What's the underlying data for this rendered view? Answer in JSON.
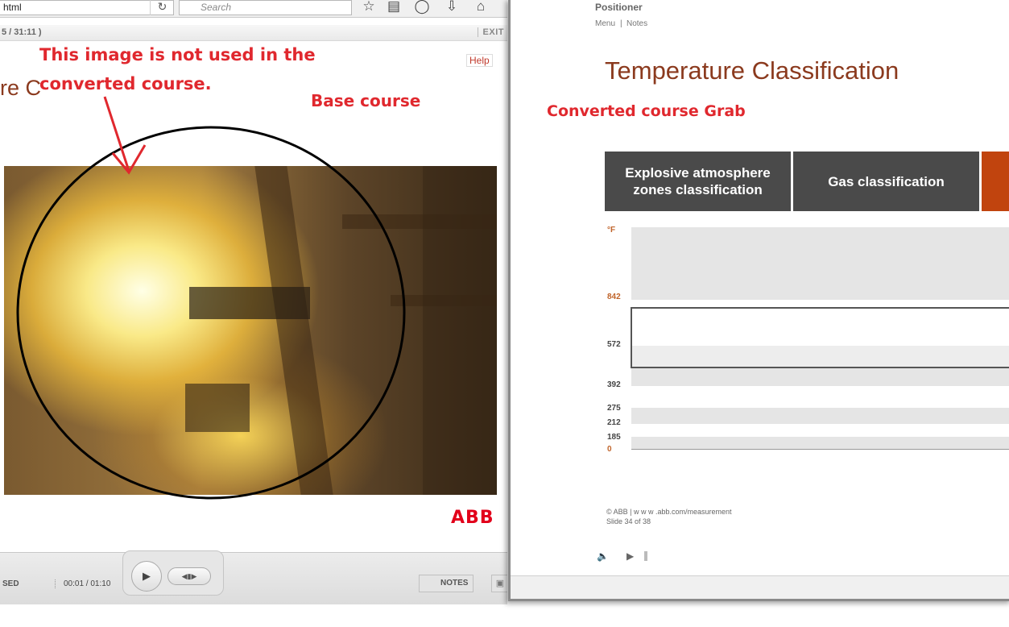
{
  "browser": {
    "url_fragment": "html",
    "reload_icon": "reload-icon",
    "search_placeholder": "Search",
    "toolbar_icons": [
      "star-icon",
      "reading-list-icon",
      "pocket-icon",
      "download-icon",
      "home-icon"
    ]
  },
  "base_player": {
    "time_total": "5 / 31:11 )",
    "exit_label": "EXIT",
    "help_label": "Help",
    "slide_title_partial": "re C",
    "logo_text": "ABB",
    "elapsed_label": "SED",
    "time_counter": "00:01 / 01:10",
    "notes_label": "NOTES"
  },
  "annotations": {
    "note": "This image is not used in the converted course.",
    "base_label": "Base course",
    "converted_label": "Converted course Grab",
    "color": "#e0282e"
  },
  "converted": {
    "course_name": "Positioner",
    "menu_label": "Menu",
    "separator": "|",
    "notes_label": "Notes",
    "title": "Temperature Classification",
    "columns": [
      "Explosive atmosphere zones classification",
      "Gas classification"
    ],
    "unit": "°F",
    "temperatures": [
      "842",
      "572",
      "392",
      "275",
      "212",
      "185",
      "0"
    ],
    "copyright": "© ABB | w w w .abb.com/measurement",
    "slide_count": "Slide 34 of 38",
    "accent_color": "#c1440e",
    "title_color": "#8b3a1e"
  }
}
